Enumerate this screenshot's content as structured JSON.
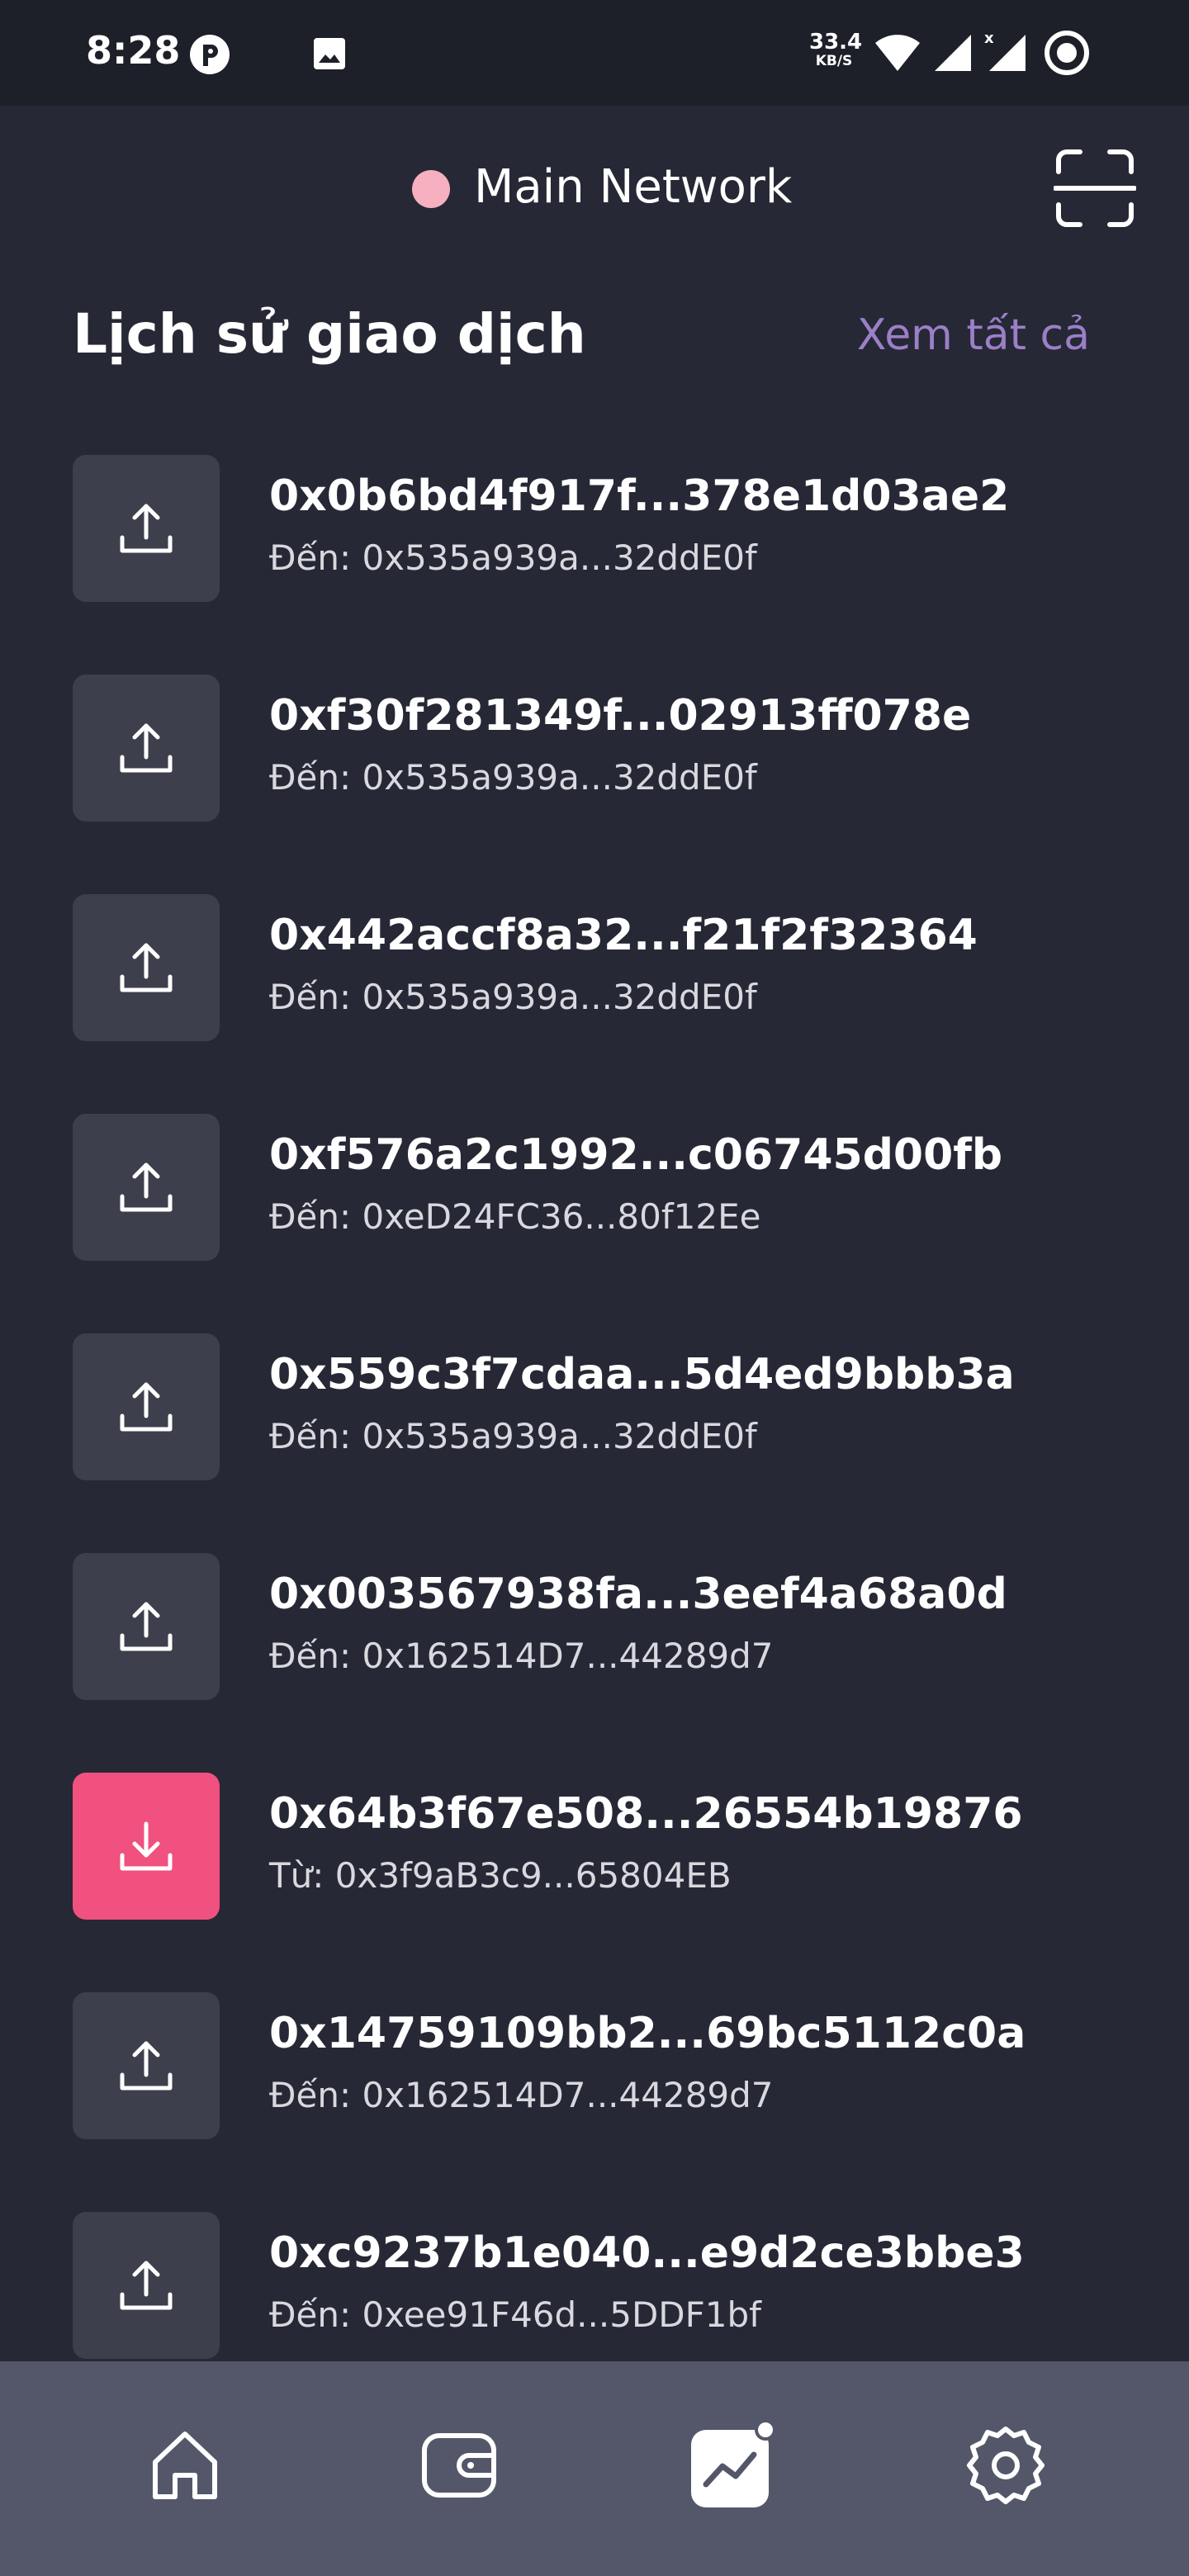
{
  "status_bar": {
    "time": "8:28",
    "speed_value": "33.4",
    "speed_unit": "KB/S",
    "icons": [
      "app-badge-icon",
      "image-icon",
      "wifi-icon",
      "signal-icon",
      "signal-roaming-icon",
      "battery-ring-icon"
    ]
  },
  "header": {
    "network_label": "Main Network",
    "network_dot_color": "#f6b0c0",
    "scan_icon": "scan-icon"
  },
  "history": {
    "title": "Lịch sử giao dịch",
    "see_all_label": "Xem tất cả",
    "see_all_color": "#9b7fc7"
  },
  "transactions": [
    {
      "hash": "0x0b6bd4f917f...378e1d03ae2",
      "counterparty": "Đến: 0x535a939a...32ddE0f",
      "direction": "out"
    },
    {
      "hash": "0xf30f281349f...02913ff078e",
      "counterparty": "Đến: 0x535a939a...32ddE0f",
      "direction": "out"
    },
    {
      "hash": "0x442accf8a32...f21f2f32364",
      "counterparty": "Đến: 0x535a939a...32ddE0f",
      "direction": "out"
    },
    {
      "hash": "0xf576a2c1992...c06745d00fb",
      "counterparty": "Đến: 0xeD24FC36...80f12Ee",
      "direction": "out"
    },
    {
      "hash": "0x559c3f7cdaa...5d4ed9bbb3a",
      "counterparty": "Đến: 0x535a939a...32ddE0f",
      "direction": "out"
    },
    {
      "hash": "0x003567938fa...3eef4a68a0d",
      "counterparty": "Đến: 0x162514D7...44289d7",
      "direction": "out"
    },
    {
      "hash": "0x64b3f67e508...26554b19876",
      "counterparty": "Từ: 0x3f9aB3c9...65804EB",
      "direction": "in"
    },
    {
      "hash": "0x14759109bb2...69bc5112c0a",
      "counterparty": "Đến: 0x162514D7...44289d7",
      "direction": "out"
    },
    {
      "hash": "0xc9237b1e040...e9d2ce3bbe3",
      "counterparty": "Đến: 0xee91F46d...5DDF1bf",
      "direction": "out"
    }
  ],
  "colors": {
    "background": "#262835",
    "tile": "#3e3f4c",
    "incoming_tile": "#f0517f",
    "nav_bar": "#545769"
  },
  "bottom_nav": {
    "items": [
      "home-icon",
      "wallet-icon",
      "activity-chart-icon",
      "settings-icon"
    ],
    "active": "activity-chart-icon"
  }
}
